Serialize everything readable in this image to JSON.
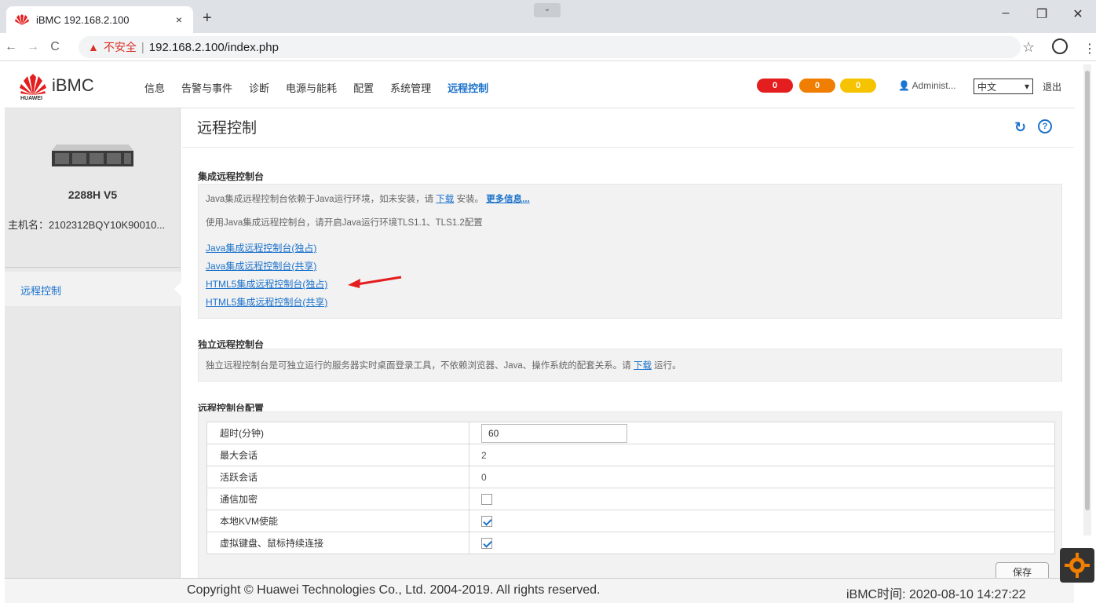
{
  "browser": {
    "tab_title": "iBMC 192.168.2.100",
    "tab_close": "×",
    "new_tab": "+",
    "insecure_label": "不安全",
    "url": "192.168.2.100/index.php",
    "window_min": "–",
    "window_restore": "❐",
    "window_close": "✕"
  },
  "header": {
    "brand": "iBMC",
    "vendor": "HUAWEI",
    "nav": [
      "信息",
      "告警与事件",
      "诊断",
      "电源与能耗",
      "配置",
      "系统管理",
      "远程控制"
    ],
    "active_nav": "远程控制",
    "alarms": {
      "critical": "0",
      "major": "0",
      "minor": "0",
      "critical_color": "#e41e1e",
      "major_color": "#f07e00",
      "minor_color": "#f6c300"
    },
    "user": "Administ...",
    "language": "中文",
    "logout": "退出"
  },
  "sidebar": {
    "model": "2288H V5",
    "hostname": "主机名：2102312BQY10K90010...",
    "nav_item": "远程控制"
  },
  "page": {
    "title": "远程控制",
    "integrated": {
      "title": "集成远程控制台",
      "desc1_pre": "Java集成远程控制台依赖于Java运行环境，如未安装，请 ",
      "desc1_link": "下载",
      "desc1_post": " 安装。",
      "more_info": "更多信息...",
      "desc2": "使用Java集成远程控制台，请开启Java运行环境TLS1.1、TLS1.2配置",
      "links": [
        "Java集成远程控制台(独占)",
        "Java集成远程控制台(共享)",
        "HTML5集成远程控制台(独占)",
        "HTML5集成远程控制台(共享)"
      ]
    },
    "standalone": {
      "title": "独立远程控制台",
      "desc_pre": "独立远程控制台是可独立运行的服务器实时桌面登录工具，不依赖浏览器、Java、操作系统的配套关系。请 ",
      "desc_link": "下载",
      "desc_post": " 运行。"
    },
    "config": {
      "title": "远程控制台配置",
      "timeout_label": "超时(分钟)",
      "timeout_value": "60",
      "max_sessions_label": "最大会话",
      "max_sessions_value": "2",
      "active_sessions_label": "活跃会话",
      "active_sessions_value": "0",
      "encryption_label": "通信加密",
      "encryption_checked": false,
      "local_kvm_label": "本地KVM使能",
      "local_kvm_checked": true,
      "persistent_label": "虚拟键盘、鼠标持续连接",
      "persistent_checked": true,
      "save": "保存"
    }
  },
  "footer": {
    "copyright": "Copyright © Huawei Technologies Co., Ltd. 2004-2019. All rights reserved.",
    "time": "iBMC时间:  2020-08-10 14:27:22"
  }
}
